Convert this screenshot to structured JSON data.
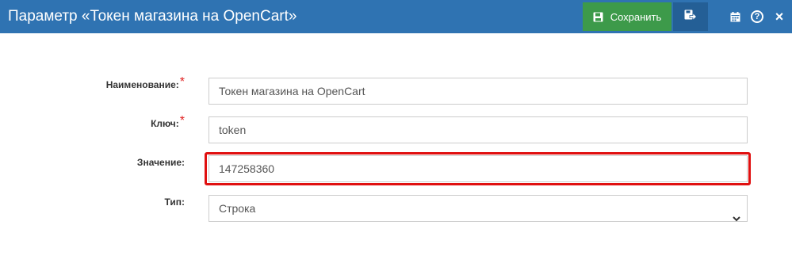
{
  "header": {
    "title": "Параметр «Токен магазина на OpenCart»",
    "save_label": "Сохранить",
    "icons": [
      "save-icon",
      "save-and-close-icon",
      "calendar-icon",
      "help-icon",
      "close-icon"
    ],
    "colors": {
      "bar": "#2f73b2",
      "save": "#3d9a4a",
      "save_close": "#245f96"
    }
  },
  "form": {
    "name": {
      "label": "Наименование:",
      "required_mark": "*",
      "value": "Токен магазина на OpenCart"
    },
    "key": {
      "label": "Ключ:",
      "required_mark": "*",
      "value": "token"
    },
    "value": {
      "label": "Значение:",
      "value": "147258360",
      "highlight_color": "#e01010"
    },
    "type": {
      "label": "Тип:",
      "selected": "Строка"
    }
  }
}
